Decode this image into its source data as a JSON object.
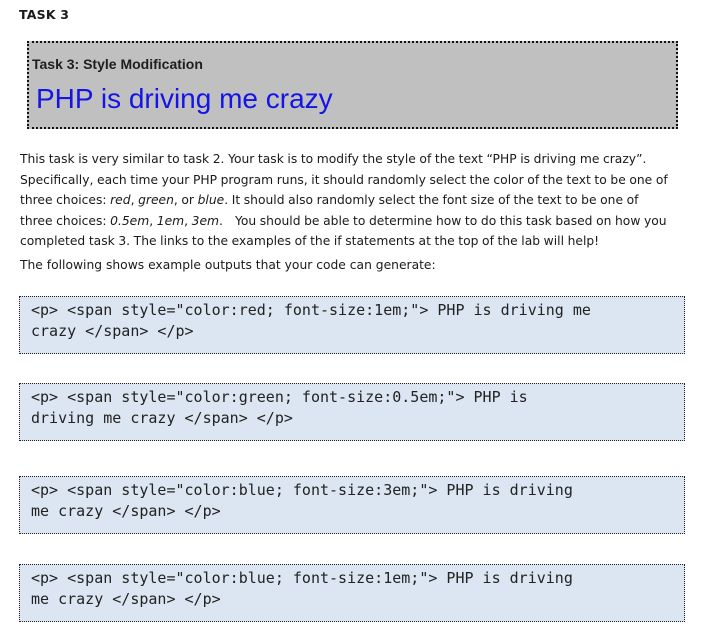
{
  "heading": "TASK 3",
  "demo": {
    "title": "Task 3: Style Modification",
    "text": "PHP is driving me crazy"
  },
  "paragraph": {
    "l1": "This task is very similar to task 2.   Your task is to modify the style of the text “PHP is driving me crazy”.",
    "l2": "Specifically, each time your PHP program runs, it should randomly select the color of the text to be one of",
    "l3_a": "three choices: ",
    "l3_red": "red",
    "l3_b": ", ",
    "l3_green": "green",
    "l3_c": ", or ",
    "l3_blue": "blue",
    "l3_d": ".   It should also randomly select the font size of the text to be one of",
    "l4_a": "three choices: ",
    "l4_s1": "0.5em",
    "l4_b": ", ",
    "l4_s2": "1em",
    "l4_c": ", ",
    "l4_s3": "3em",
    "l4_d": ".",
    "l4_e": "You should be able to determine how to do this task based on how you",
    "l5": "completed task 3.  The links to the examples of the if statements at the top of the lab will help!"
  },
  "intro": "The following shows example outputs that your code can generate:",
  "examples": [
    {
      "line1": "<p> <span style=\"color:red; font-size:1em;\"> PHP is driving me",
      "line2": "crazy </span> </p>"
    },
    {
      "line1": "<p> <span style=\"color:green; font-size:0.5em;\"> PHP is",
      "line2": "driving me crazy </span> </p>"
    },
    {
      "line1": "<p> <span style=\"color:blue; font-size:3em;\"> PHP is driving",
      "line2": "me crazy </span> </p>"
    },
    {
      "line1": "<p> <span style=\"color:blue; font-size:1em;\"> PHP is driving",
      "line2": "me crazy </span> </p>"
    }
  ]
}
